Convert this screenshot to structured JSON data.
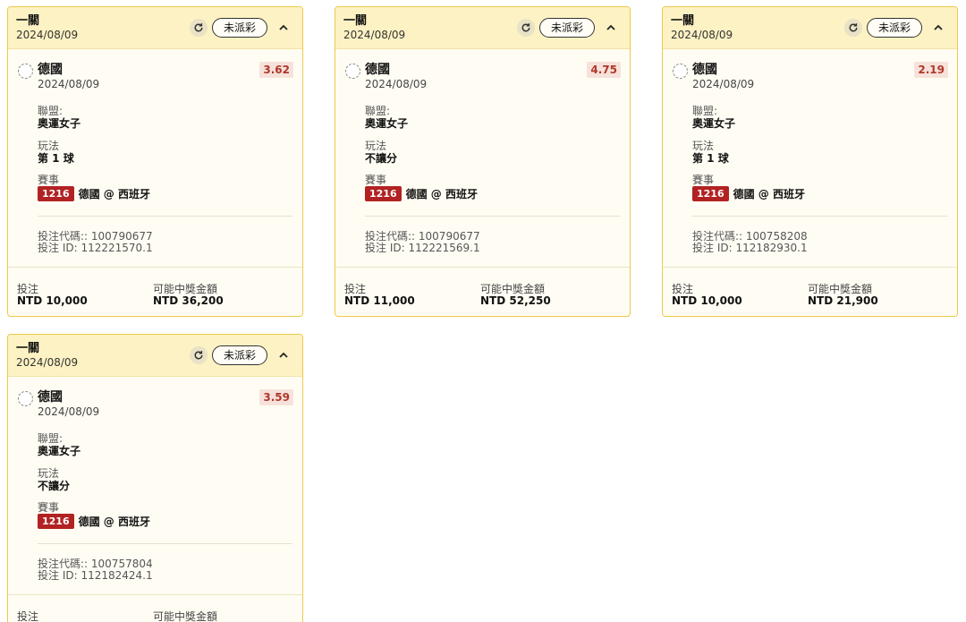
{
  "labels": {
    "league": "聯盟:",
    "play": "玩法",
    "match": "賽事",
    "bet_code_prefix": "投注代碼:: ",
    "bet_id_prefix": "投注 ID: ",
    "stake": "投注",
    "potential_win": "可能中獎金額"
  },
  "colors": {
    "card_border": "#ecc94b",
    "header_bg": "#fdf2c3",
    "card_bg": "#fffdf3",
    "odds_bg": "#f7e2db",
    "odds_text": "#b0382a",
    "match_id_bg": "#b22222"
  },
  "icons": {
    "refresh": "refresh-icon",
    "collapse": "chevron-up-icon",
    "select": "radio-icon"
  },
  "cards": [
    {
      "title": "一關",
      "date": "2024/08/09",
      "status": "未派彩",
      "team": "德國",
      "team_date": "2024/08/09",
      "odds": "3.62",
      "league": "奧運女子",
      "play": "第 1 球",
      "match_id": "1216",
      "match_name": "德國 @ 西班牙",
      "bet_code": "100790677",
      "bet_id": "112221570.1",
      "stake": "NTD 10,000",
      "potential_win": "NTD 36,200"
    },
    {
      "title": "一關",
      "date": "2024/08/09",
      "status": "未派彩",
      "team": "德國",
      "team_date": "2024/08/09",
      "odds": "4.75",
      "league": "奧運女子",
      "play": "不讓分",
      "match_id": "1216",
      "match_name": "德國 @ 西班牙",
      "bet_code": "100790677",
      "bet_id": "112221569.1",
      "stake": "NTD 11,000",
      "potential_win": "NTD 52,250"
    },
    {
      "title": "一關",
      "date": "2024/08/09",
      "status": "未派彩",
      "team": "德國",
      "team_date": "2024/08/09",
      "odds": "2.19",
      "league": "奧運女子",
      "play": "第 1 球",
      "match_id": "1216",
      "match_name": "德國 @ 西班牙",
      "bet_code": "100758208",
      "bet_id": "112182930.1",
      "stake": "NTD 10,000",
      "potential_win": "NTD 21,900"
    },
    {
      "title": "一關",
      "date": "2024/08/09",
      "status": "未派彩",
      "team": "德國",
      "team_date": "2024/08/09",
      "odds": "3.59",
      "league": "奧運女子",
      "play": "不讓分",
      "match_id": "1216",
      "match_name": "德國 @ 西班牙",
      "bet_code": "100757804",
      "bet_id": "112182424.1",
      "stake": "",
      "potential_win": ""
    }
  ]
}
